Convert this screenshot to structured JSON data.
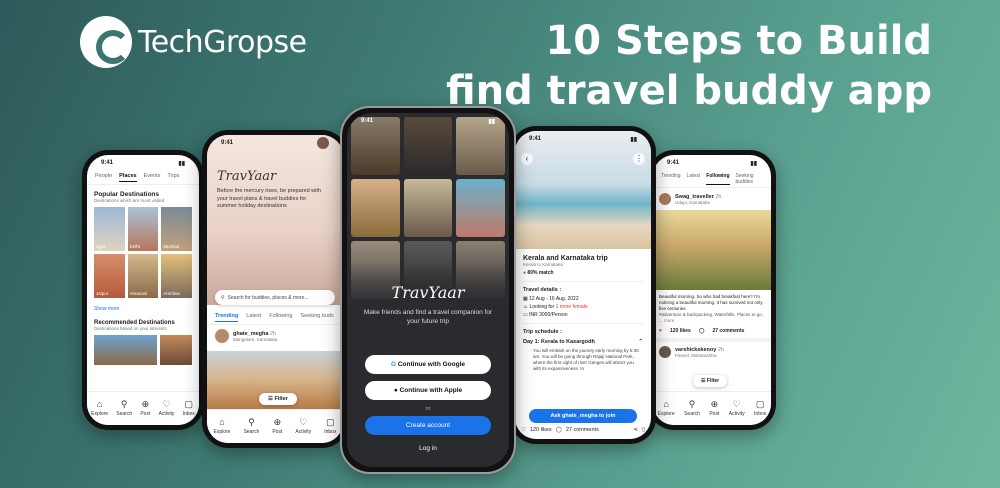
{
  "brand": {
    "name": "TechGropse"
  },
  "headline": {
    "line1": "10 Steps to Build",
    "line2": "find travel buddy app"
  },
  "status_time": "9:41",
  "phone1": {
    "tabs": [
      "People",
      "Places",
      "Events",
      "Trips"
    ],
    "section1_title": "Popular Destinations",
    "section1_sub": "Destinations which are most visited",
    "places": [
      "Agra",
      "Delhi",
      "Mumbai",
      "Jaipur",
      "Varanasi",
      "Amritsar"
    ],
    "show_more": "Show more",
    "section2_title": "Recommended Destinations",
    "section2_sub": "Destinations based on your interests",
    "nav": [
      "Explore",
      "Search",
      "Post",
      "Activity",
      "Inbox"
    ]
  },
  "phone2": {
    "app_name": "TravYaar",
    "hero_text": "Before the mercury rises, be prepared with your travel plans & travel buddies for summer holiday destinations",
    "search_placeholder": "Search for buddies, places & more...",
    "tabs": [
      "Trending",
      "Latest",
      "Following",
      "Seeking buds"
    ],
    "user": "ghate_megha",
    "time": "2h",
    "location": "Mangalore, Karnataka",
    "filter": "Filter",
    "nav": [
      "Explore",
      "Search",
      "Post",
      "Activity",
      "Inbox"
    ]
  },
  "phone3": {
    "app_name": "TravYaar",
    "tagline": "Make friends and find a travel companion for your future trip",
    "google": "Continue with Google",
    "apple": "Continue with Apple",
    "or": "or",
    "create": "Create account",
    "login": "Log in"
  },
  "phone4": {
    "trip_title": "Kerala and Karnataka trip",
    "trip_sub": "Kerala to Karnataka",
    "match": "80% match",
    "details_label": "Travel details :",
    "dates": "12 Aug - 16 Aug, 2022",
    "looking_for": "Looking for",
    "looking_value": "1 more female",
    "budget": "INR 3000/Person",
    "schedule_label": "Trip schedule :",
    "day1": "Day 1: Kerala to Kasargodh",
    "day1_text": "You will embark on the journey early morning by 5:30 am. You will be going through Rajaji National Park, where the first sight of river Ganges will attract you with its expansiveness. In",
    "ask_button": "Ask ghate_megha to join",
    "likes": "120 likes",
    "comments": "27 comments"
  },
  "phone5": {
    "tabs": [
      "Trending",
      "Latest",
      "Following",
      "Seeking buddies"
    ],
    "user1": "Swag_traveller",
    "time1": "2h",
    "loc1": "Udupi, Karnataka",
    "caption": "Beautiful morning. So who had breakfast here? I'm noticing a beautiful morning. It has survived not only five centuries.",
    "tags": "#adventure & backpacking, Waterfalls, Places to go, ...",
    "more": "more",
    "likes": "120 likes",
    "comments": "27 comments",
    "user2": "varshickskenoy",
    "time2": "2h",
    "loc2": "Panvel, Maharashtra",
    "filter": "Filter",
    "nav": [
      "Explore",
      "Search",
      "Post",
      "Activity",
      "Inbox"
    ]
  }
}
